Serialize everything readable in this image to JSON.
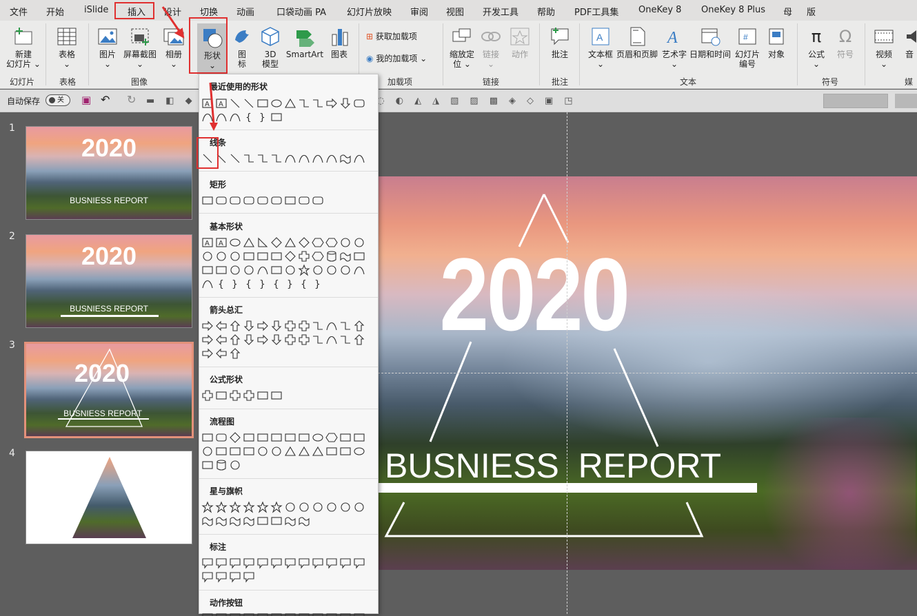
{
  "menu": {
    "file": "文件",
    "home": "开始",
    "islide": "iSlide",
    "insert": "插入",
    "design": "设计",
    "transitions": "切换",
    "animations": "动画",
    "pocket": "口袋动画 PA",
    "slideshow": "幻灯片放映",
    "review": "审阅",
    "view": "视图",
    "developer": "开发工具",
    "help": "帮助",
    "pdf": "PDF工具集",
    "onekey8": "OneKey 8",
    "onekey8plus": "OneKey 8 Plus",
    "mother": "母",
    "edition": "版"
  },
  "ribbon": {
    "new_slide": "新建\n幻灯片 ⌄",
    "table": "表格\n⌄",
    "picture": "图片\n⌄",
    "screenshot": "屏幕截图\n⌄",
    "album": "相册\n⌄",
    "shapes": "形状\n⌄",
    "icons": "图\n标",
    "model3d": "3D\n模型",
    "smartart": "SmartArt",
    "chart": "图表",
    "get_addins": "获取加载项",
    "my_addins": "我的加载项",
    "zoom": "缩放定\n位 ⌄",
    "link": "链接\n⌄",
    "action": "动作",
    "comment": "批注",
    "textbox": "文本框\n⌄",
    "header_footer": "页眉和页脚",
    "wordart": "艺术字\n⌄",
    "datetime": "日期和时间",
    "slide_number": "幻灯片\n编号",
    "object": "对象",
    "equation": "公式\n⌄",
    "symbol": "符号",
    "video": "视频\n⌄",
    "audio": "音",
    "groups": {
      "slides": "幻灯片",
      "tables": "表格",
      "images": "图像",
      "addins": "加载项",
      "links": "链接",
      "comments": "批注",
      "text": "文本",
      "symbols": "符号",
      "media": "媒"
    }
  },
  "qat": {
    "autosave": "自动保存",
    "off": "关"
  },
  "thumbnails": [
    {
      "num": "1",
      "title": "2020",
      "subtitle": "BUSNIESS  REPORT"
    },
    {
      "num": "2",
      "title": "2020",
      "subtitle": "BUSNIESS  REPORT"
    },
    {
      "num": "3",
      "title": "2020",
      "subtitle": "BUSNIESS  REPORT"
    },
    {
      "num": "4"
    }
  ],
  "shapes_panel": {
    "recent": "最近使用的形状",
    "lines": "线条",
    "rectangles": "矩形",
    "basic": "基本形状",
    "arrows": "箭头总汇",
    "equation": "公式形状",
    "flowchart": "流程图",
    "stars": "星与旗帜",
    "callouts": "标注",
    "action_buttons": "动作按钮",
    "recent_extra": "{ }"
  },
  "slide": {
    "title": "2020",
    "subtitle": "BUSNIESS  REPORT"
  },
  "colors": {
    "highlight": "#e03030",
    "ribbon": "#ebebea",
    "menubar": "#e1e0df"
  }
}
